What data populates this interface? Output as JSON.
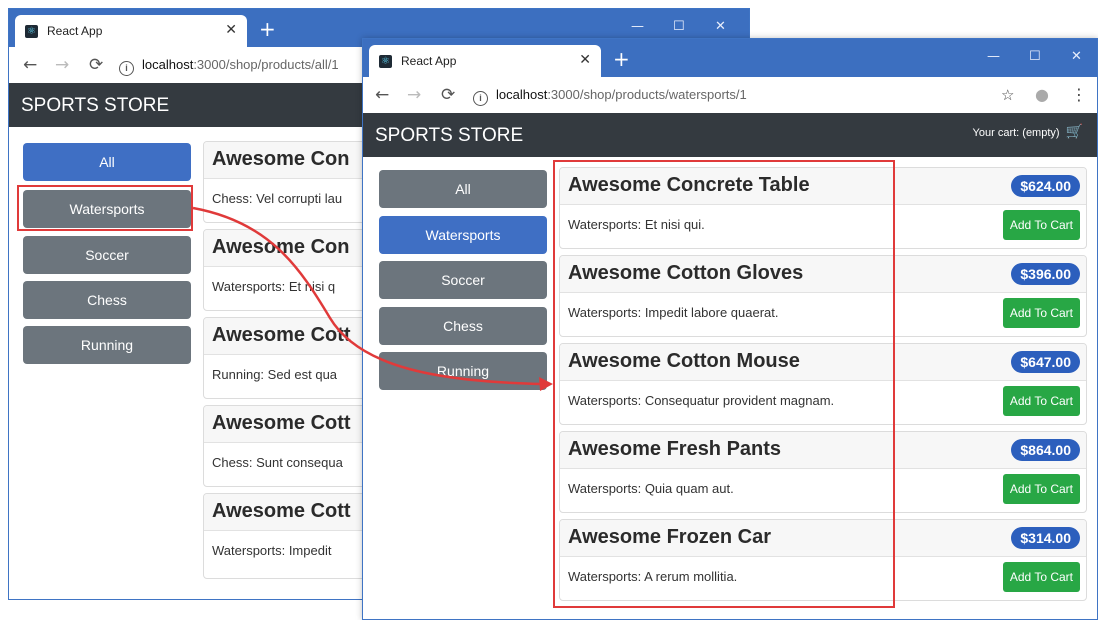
{
  "browser_back": {
    "tab_title": "React App",
    "url_host": "localhost",
    "url_path": ":3000/shop/products/all/1",
    "brand": "SPORTS STORE",
    "categories": [
      "All",
      "Watersports",
      "Soccer",
      "Chess",
      "Running"
    ],
    "active_category": "All",
    "products": [
      {
        "name": "Awesome Con",
        "description": "Chess: Vel corrupti lau"
      },
      {
        "name": "Awesome Con",
        "description": "Watersports: Et nisi q"
      },
      {
        "name": "Awesome Cott",
        "description": "Running: Sed est qua"
      },
      {
        "name": "Awesome Cott",
        "description": "Chess: Sunt consequa"
      },
      {
        "name": "Awesome Cott",
        "description": "Watersports: Impedit"
      }
    ]
  },
  "browser_front": {
    "tab_title": "React App",
    "url_host": "localhost",
    "url_path": ":3000/shop/products/watersports/1",
    "brand": "SPORTS STORE",
    "cart_text": "Your cart: (empty)",
    "categories": [
      "All",
      "Watersports",
      "Soccer",
      "Chess",
      "Running"
    ],
    "active_category": "Watersports",
    "add_label": "Add To Cart",
    "products": [
      {
        "name": "Awesome Concrete Table",
        "price": "$624.00",
        "description": "Watersports: Et nisi qui."
      },
      {
        "name": "Awesome Cotton Gloves",
        "price": "$396.00",
        "description": "Watersports: Impedit labore quaerat."
      },
      {
        "name": "Awesome Cotton Mouse",
        "price": "$647.00",
        "description": "Watersports: Consequatur provident magnam."
      },
      {
        "name": "Awesome Fresh Pants",
        "price": "$864.00",
        "description": "Watersports: Quia quam aut."
      },
      {
        "name": "Awesome Frozen Car",
        "price": "$314.00",
        "description": "Watersports: A rerum mollitia."
      }
    ]
  },
  "icons": {
    "back": "back-arrow-icon",
    "forward": "forward-arrow-icon",
    "reload": "reload-icon",
    "info": "info-icon",
    "star": "star-icon",
    "account": "account-icon",
    "menu": "menu-dots-icon",
    "cart": "cart-icon",
    "tab_close": "close-icon",
    "new_tab": "plus-icon"
  },
  "colors": {
    "titlebar": "#3c6fc0",
    "header": "#343a40",
    "active_category": "#3f6fc4",
    "inactive_category": "#6c757d",
    "price_badge": "#2c5fbd",
    "add_button": "#28a745",
    "highlight": "#e03a3a"
  }
}
